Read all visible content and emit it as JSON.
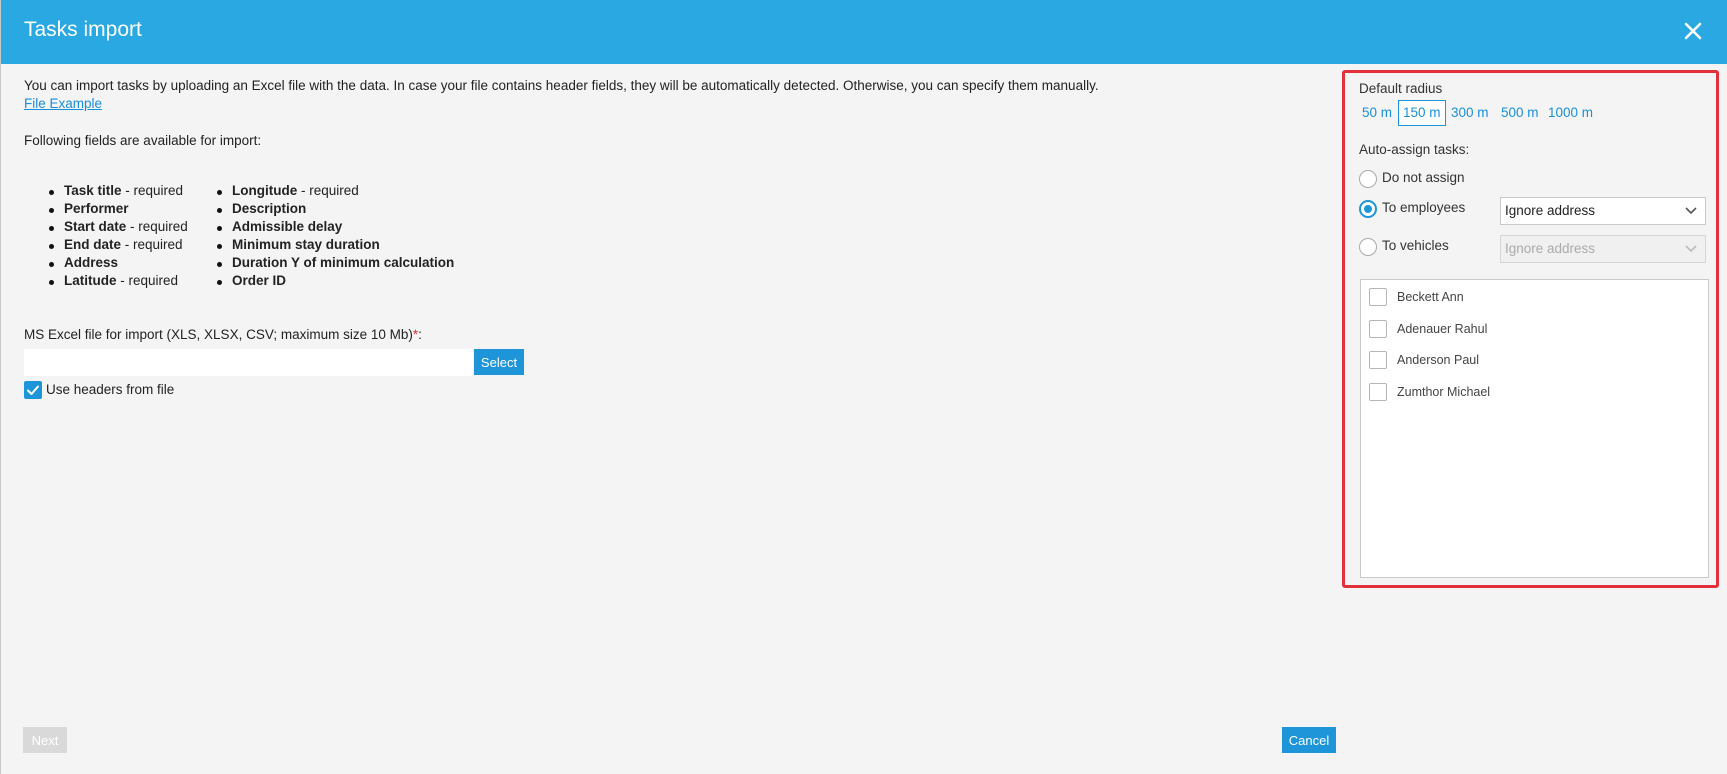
{
  "header": {
    "title": "Tasks import",
    "close_icon": "close-icon"
  },
  "intro": {
    "text": "You can import tasks by uploading an Excel file with the data. In case your file contains header fields, they will be automatically detected. Otherwise, you can specify them manually.",
    "file_example_link": "File Example",
    "fields_heading": "Following fields are available for import:"
  },
  "fields": {
    "column1": [
      {
        "name": "Task title",
        "suffix": " - required"
      },
      {
        "name": "Performer",
        "suffix": ""
      },
      {
        "name": "Start date",
        "suffix": " - required"
      },
      {
        "name": "End date",
        "suffix": " - required"
      },
      {
        "name": "Address",
        "suffix": ""
      },
      {
        "name": "Latitude",
        "suffix": " - required"
      }
    ],
    "column2": [
      {
        "name": "Longitude",
        "suffix": " - required"
      },
      {
        "name": "Description",
        "suffix": ""
      },
      {
        "name": "Admissible delay",
        "suffix": ""
      },
      {
        "name": "Minimum stay duration",
        "suffix": ""
      },
      {
        "name": "Duration Y of minimum calculation",
        "suffix": ""
      },
      {
        "name": "Order ID",
        "suffix": ""
      }
    ]
  },
  "upload": {
    "label": "MS Excel file for import (XLS, XLSX, CSV; maximum size 10 Mb)",
    "required_mark": "*",
    "label_colon": ":",
    "file_value": "",
    "select_label": "Select",
    "use_headers_label": "Use headers from file",
    "use_headers_checked": true
  },
  "footer": {
    "next_label": "Next",
    "cancel_label": "Cancel"
  },
  "sidebar": {
    "radius_label": "Default radius",
    "radius_options": [
      "50 m",
      "150 m",
      "300 m",
      "500 m",
      "1000 m"
    ],
    "radius_selected": "150 m",
    "auto_assign_label": "Auto-assign tasks:",
    "assign_options": [
      {
        "label": "Do not assign",
        "selected": false
      },
      {
        "label": "To employees",
        "selected": true
      },
      {
        "label": "To vehicles",
        "selected": false
      }
    ],
    "employees_dropdown_value": "Ignore address",
    "vehicles_dropdown_value": "Ignore address",
    "employees": [
      "Beckett Ann",
      "Adenauer Rahul",
      "Anderson Paul",
      "Zumthor Michael"
    ]
  },
  "colors": {
    "header": "#29a8e2",
    "primary": "#1e95d8",
    "highlight_border": "#e1313a",
    "background": "#f4f4f4"
  }
}
